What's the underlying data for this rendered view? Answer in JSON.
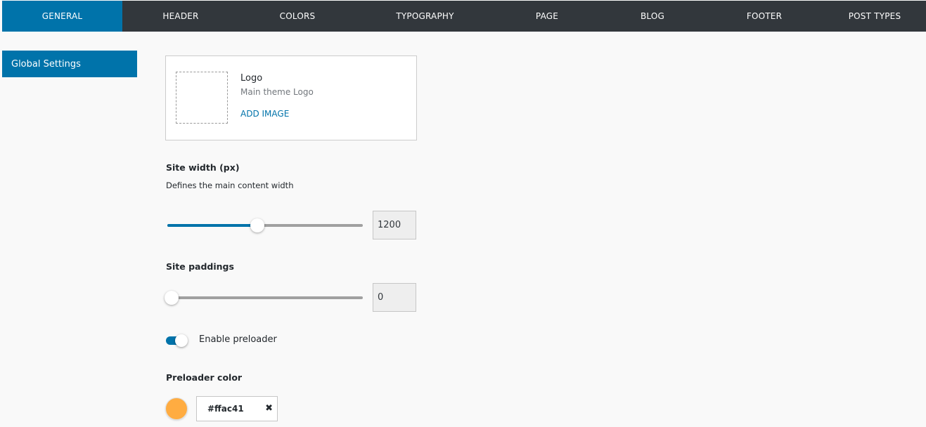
{
  "tabs": [
    {
      "label": "GENERAL",
      "active": true
    },
    {
      "label": "HEADER",
      "active": false
    },
    {
      "label": "COLORS",
      "active": false
    },
    {
      "label": "TYPOGRAPHY",
      "active": false
    },
    {
      "label": "PAGE",
      "active": false
    },
    {
      "label": "BLOG",
      "active": false
    },
    {
      "label": "FOOTER",
      "active": false
    },
    {
      "label": "POST TYPES",
      "active": false
    }
  ],
  "sidebar": {
    "items": [
      {
        "label": "Global Settings",
        "active": true
      }
    ]
  },
  "logo": {
    "title": "Logo",
    "description": "Main theme Logo",
    "add_label": "ADD IMAGE"
  },
  "site_width": {
    "label": "Site width (px)",
    "description": "Defines the main content width",
    "value": "1200",
    "level_fraction": 0.46
  },
  "site_paddings": {
    "label": "Site paddings",
    "value": "0",
    "level_fraction": 0.0
  },
  "preloader": {
    "toggle_label": "Enable preloader",
    "enabled": true
  },
  "preloader_color": {
    "label": "Preloader color",
    "value": "#ffac41",
    "swatch_color": "#ffac41",
    "clear_icon": "close-icon"
  },
  "colors": {
    "accent": "#0073aa",
    "tabbar": "#32373c"
  }
}
